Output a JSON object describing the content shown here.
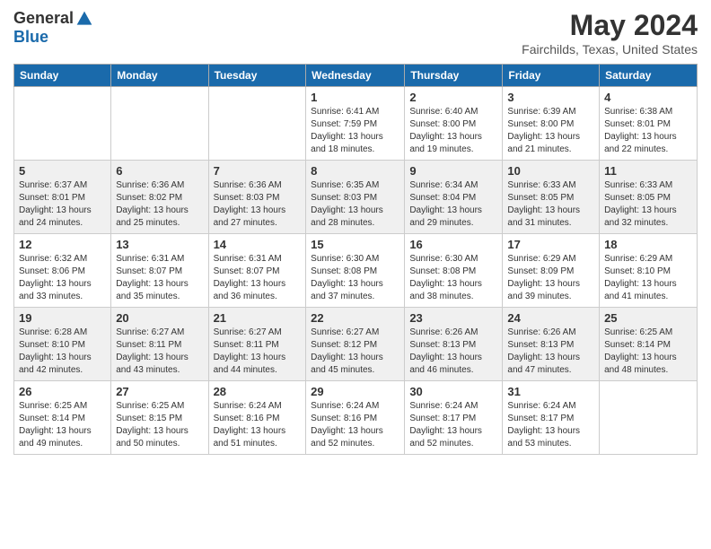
{
  "header": {
    "logo_general": "General",
    "logo_blue": "Blue",
    "title": "May 2024",
    "subtitle": "Fairchilds, Texas, United States"
  },
  "days_of_week": [
    "Sunday",
    "Monday",
    "Tuesday",
    "Wednesday",
    "Thursday",
    "Friday",
    "Saturday"
  ],
  "weeks": [
    {
      "days": [
        {
          "num": "",
          "info": ""
        },
        {
          "num": "",
          "info": ""
        },
        {
          "num": "",
          "info": ""
        },
        {
          "num": "1",
          "info": "Sunrise: 6:41 AM\nSunset: 7:59 PM\nDaylight: 13 hours and 18 minutes."
        },
        {
          "num": "2",
          "info": "Sunrise: 6:40 AM\nSunset: 8:00 PM\nDaylight: 13 hours and 19 minutes."
        },
        {
          "num": "3",
          "info": "Sunrise: 6:39 AM\nSunset: 8:00 PM\nDaylight: 13 hours and 21 minutes."
        },
        {
          "num": "4",
          "info": "Sunrise: 6:38 AM\nSunset: 8:01 PM\nDaylight: 13 hours and 22 minutes."
        }
      ]
    },
    {
      "days": [
        {
          "num": "5",
          "info": "Sunrise: 6:37 AM\nSunset: 8:01 PM\nDaylight: 13 hours and 24 minutes."
        },
        {
          "num": "6",
          "info": "Sunrise: 6:36 AM\nSunset: 8:02 PM\nDaylight: 13 hours and 25 minutes."
        },
        {
          "num": "7",
          "info": "Sunrise: 6:36 AM\nSunset: 8:03 PM\nDaylight: 13 hours and 27 minutes."
        },
        {
          "num": "8",
          "info": "Sunrise: 6:35 AM\nSunset: 8:03 PM\nDaylight: 13 hours and 28 minutes."
        },
        {
          "num": "9",
          "info": "Sunrise: 6:34 AM\nSunset: 8:04 PM\nDaylight: 13 hours and 29 minutes."
        },
        {
          "num": "10",
          "info": "Sunrise: 6:33 AM\nSunset: 8:05 PM\nDaylight: 13 hours and 31 minutes."
        },
        {
          "num": "11",
          "info": "Sunrise: 6:33 AM\nSunset: 8:05 PM\nDaylight: 13 hours and 32 minutes."
        }
      ]
    },
    {
      "days": [
        {
          "num": "12",
          "info": "Sunrise: 6:32 AM\nSunset: 8:06 PM\nDaylight: 13 hours and 33 minutes."
        },
        {
          "num": "13",
          "info": "Sunrise: 6:31 AM\nSunset: 8:07 PM\nDaylight: 13 hours and 35 minutes."
        },
        {
          "num": "14",
          "info": "Sunrise: 6:31 AM\nSunset: 8:07 PM\nDaylight: 13 hours and 36 minutes."
        },
        {
          "num": "15",
          "info": "Sunrise: 6:30 AM\nSunset: 8:08 PM\nDaylight: 13 hours and 37 minutes."
        },
        {
          "num": "16",
          "info": "Sunrise: 6:30 AM\nSunset: 8:08 PM\nDaylight: 13 hours and 38 minutes."
        },
        {
          "num": "17",
          "info": "Sunrise: 6:29 AM\nSunset: 8:09 PM\nDaylight: 13 hours and 39 minutes."
        },
        {
          "num": "18",
          "info": "Sunrise: 6:29 AM\nSunset: 8:10 PM\nDaylight: 13 hours and 41 minutes."
        }
      ]
    },
    {
      "days": [
        {
          "num": "19",
          "info": "Sunrise: 6:28 AM\nSunset: 8:10 PM\nDaylight: 13 hours and 42 minutes."
        },
        {
          "num": "20",
          "info": "Sunrise: 6:27 AM\nSunset: 8:11 PM\nDaylight: 13 hours and 43 minutes."
        },
        {
          "num": "21",
          "info": "Sunrise: 6:27 AM\nSunset: 8:11 PM\nDaylight: 13 hours and 44 minutes."
        },
        {
          "num": "22",
          "info": "Sunrise: 6:27 AM\nSunset: 8:12 PM\nDaylight: 13 hours and 45 minutes."
        },
        {
          "num": "23",
          "info": "Sunrise: 6:26 AM\nSunset: 8:13 PM\nDaylight: 13 hours and 46 minutes."
        },
        {
          "num": "24",
          "info": "Sunrise: 6:26 AM\nSunset: 8:13 PM\nDaylight: 13 hours and 47 minutes."
        },
        {
          "num": "25",
          "info": "Sunrise: 6:25 AM\nSunset: 8:14 PM\nDaylight: 13 hours and 48 minutes."
        }
      ]
    },
    {
      "days": [
        {
          "num": "26",
          "info": "Sunrise: 6:25 AM\nSunset: 8:14 PM\nDaylight: 13 hours and 49 minutes."
        },
        {
          "num": "27",
          "info": "Sunrise: 6:25 AM\nSunset: 8:15 PM\nDaylight: 13 hours and 50 minutes."
        },
        {
          "num": "28",
          "info": "Sunrise: 6:24 AM\nSunset: 8:16 PM\nDaylight: 13 hours and 51 minutes."
        },
        {
          "num": "29",
          "info": "Sunrise: 6:24 AM\nSunset: 8:16 PM\nDaylight: 13 hours and 52 minutes."
        },
        {
          "num": "30",
          "info": "Sunrise: 6:24 AM\nSunset: 8:17 PM\nDaylight: 13 hours and 52 minutes."
        },
        {
          "num": "31",
          "info": "Sunrise: 6:24 AM\nSunset: 8:17 PM\nDaylight: 13 hours and 53 minutes."
        },
        {
          "num": "",
          "info": ""
        }
      ]
    }
  ]
}
